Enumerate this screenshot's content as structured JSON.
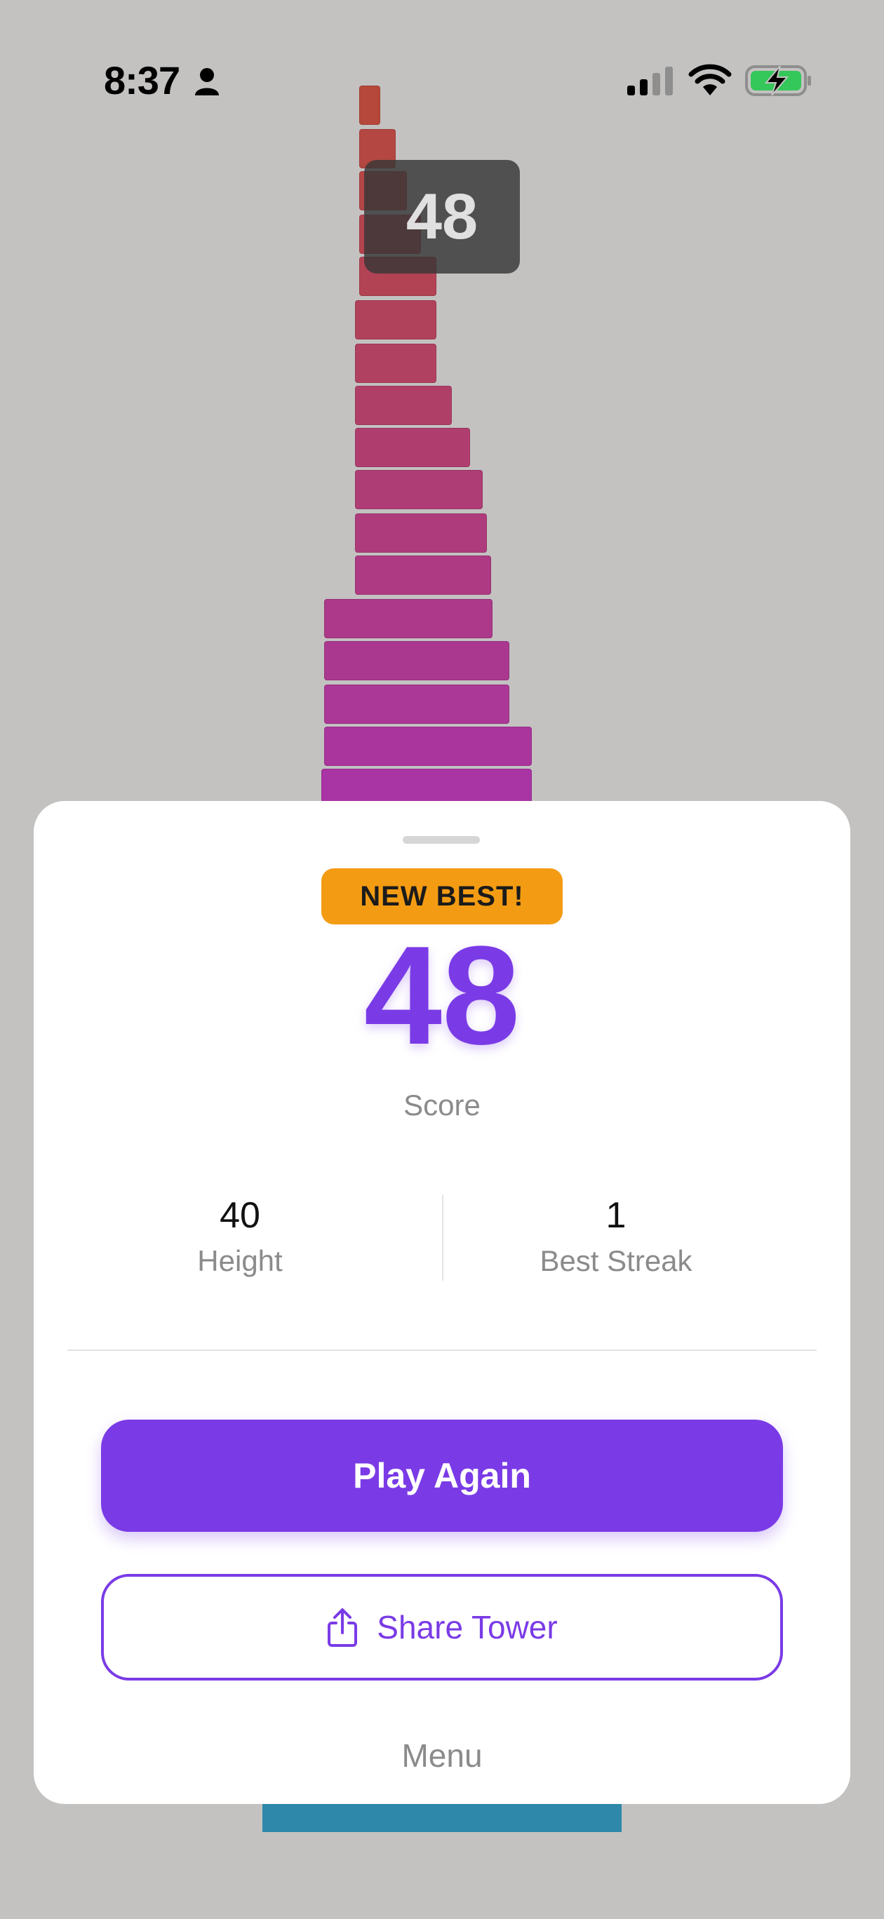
{
  "status_bar": {
    "time": "8:37",
    "icons": [
      "person-icon",
      "signal-icon",
      "wifi-icon",
      "battery-charging-icon"
    ],
    "battery_color": "#34c759"
  },
  "game": {
    "current_score": "48",
    "tower_block_count": 17,
    "tower_colors": {
      "top": "#b5483a",
      "bottom": "#a934a3",
      "base": "#2e88aa"
    }
  },
  "results": {
    "badge": "NEW BEST!",
    "score": "48",
    "score_label": "Score",
    "stats": [
      {
        "value": "40",
        "label": "Height"
      },
      {
        "value": "1",
        "label": "Best Streak"
      }
    ],
    "play_again": "Play Again",
    "share": "Share Tower",
    "menu": "Menu"
  },
  "colors": {
    "accent": "#7a3be6",
    "badge": "#f39c13",
    "background": "#c3c2c1"
  }
}
